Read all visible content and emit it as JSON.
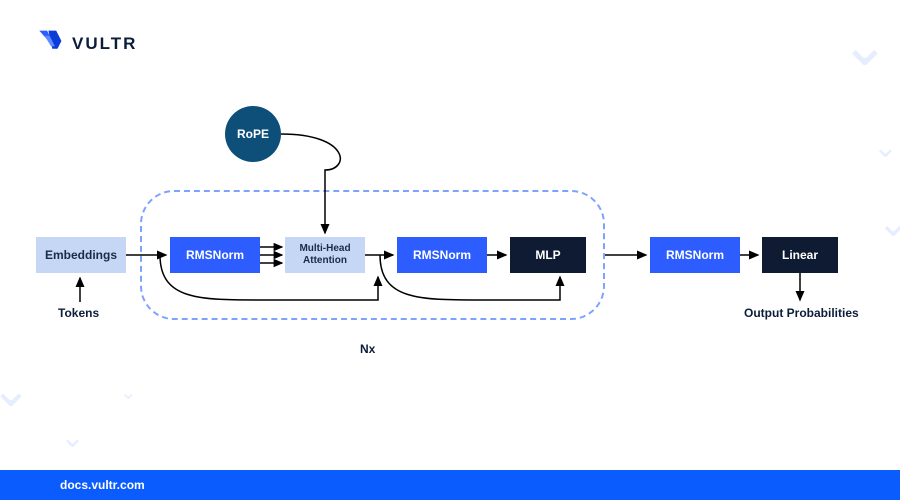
{
  "brand": {
    "name": "VULTR",
    "accent_blue": "#2d5cff",
    "dark_navy": "#0e1b33",
    "circle_teal": "#0e4f7a",
    "light_blue": "#c6d7f5",
    "footer_blue": "#0a5cff"
  },
  "footer": {
    "text": "docs.vultr.com"
  },
  "diagram": {
    "input_label": "Tokens",
    "output_label": "Output Probabilities",
    "repeat_label": "Nx",
    "blocks": {
      "embeddings": "Embeddings",
      "rmsnorm1": "RMSNorm",
      "attention": "Multi-Head Attention",
      "rope": "RoPE",
      "rmsnorm2": "RMSNorm",
      "mlp": "MLP",
      "rmsnorm3": "RMSNorm",
      "linear": "Linear"
    }
  }
}
